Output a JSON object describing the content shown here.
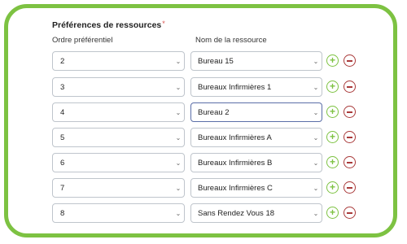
{
  "section": {
    "title": "Préférences de ressources",
    "required_mark": "*",
    "col_order": "Ordre préférentiel",
    "col_name": "Nom de la ressource"
  },
  "rows": [
    {
      "order": "2",
      "name": "Bureau 15"
    },
    {
      "order": "3",
      "name": "Bureaux Infirmières 1"
    },
    {
      "order": "4",
      "name": "Bureau 2"
    },
    {
      "order": "5",
      "name": "Bureaux Infirmières A"
    },
    {
      "order": "6",
      "name": "Bureaux Infirmières B"
    },
    {
      "order": "7",
      "name": "Bureaux Infirmières C"
    },
    {
      "order": "8",
      "name": "Sans Rendez Vous 18"
    }
  ],
  "icons": {
    "dropdown": "chevron-down-icon",
    "add": "plus-circle-icon",
    "remove": "minus-circle-icon"
  },
  "colors": {
    "frame_accent": "#7dc242",
    "add_color": "#7dc242",
    "remove_color": "#a93a3a",
    "required_color": "#d9534f",
    "focused_border": "#5b6ea8"
  }
}
